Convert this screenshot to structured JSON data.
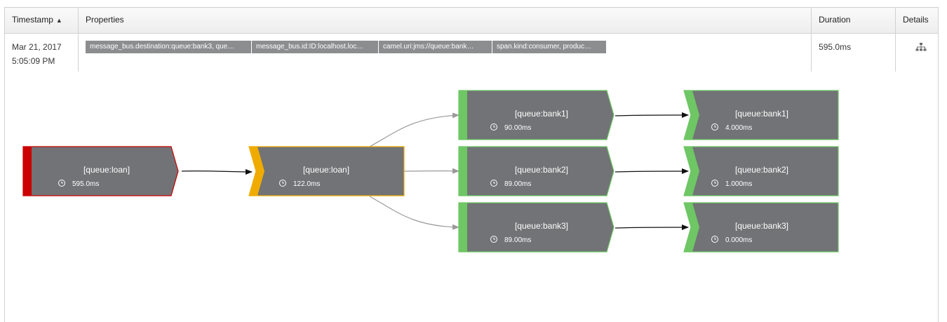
{
  "table": {
    "headers": {
      "timestamp": "Timestamp",
      "properties": "Properties",
      "duration": "Duration",
      "details": "Details"
    },
    "row": {
      "date": "Mar 21, 2017",
      "time": "5:05:09 PM",
      "tags": [
        "message_bus.destination:queue:bank3, que…",
        "message_bus.id:ID:localhost.loc…",
        "camel.uri:jms://queue:bank…",
        "span.kind:consumer, produc…"
      ],
      "duration": "595.0ms"
    }
  },
  "graph": {
    "colors": {
      "node_fill": "#717376",
      "error": "#cc0000",
      "warning": "#f0ab00",
      "ok": "#6ec664",
      "edge_grey": "#9a9a9a",
      "edge_black": "#111111"
    },
    "nodes": [
      {
        "id": "loan-root",
        "title": "[queue:loan]",
        "duration": "595.0ms",
        "status": "error"
      },
      {
        "id": "loan-child",
        "title": "[queue:loan]",
        "duration": "122.0ms",
        "status": "warning"
      },
      {
        "id": "bank1-a",
        "title": "[queue:bank1]",
        "duration": "90.00ms",
        "status": "ok"
      },
      {
        "id": "bank2-a",
        "title": "[queue:bank2]",
        "duration": "89.00ms",
        "status": "ok"
      },
      {
        "id": "bank3-a",
        "title": "[queue:bank3]",
        "duration": "89.00ms",
        "status": "ok"
      },
      {
        "id": "bank1-b",
        "title": "[queue:bank1]",
        "duration": "4.000ms",
        "status": "ok"
      },
      {
        "id": "bank2-b",
        "title": "[queue:bank2]",
        "duration": "1.000ms",
        "status": "ok"
      },
      {
        "id": "bank3-b",
        "title": "[queue:bank3]",
        "duration": "0.000ms",
        "status": "ok"
      }
    ]
  }
}
